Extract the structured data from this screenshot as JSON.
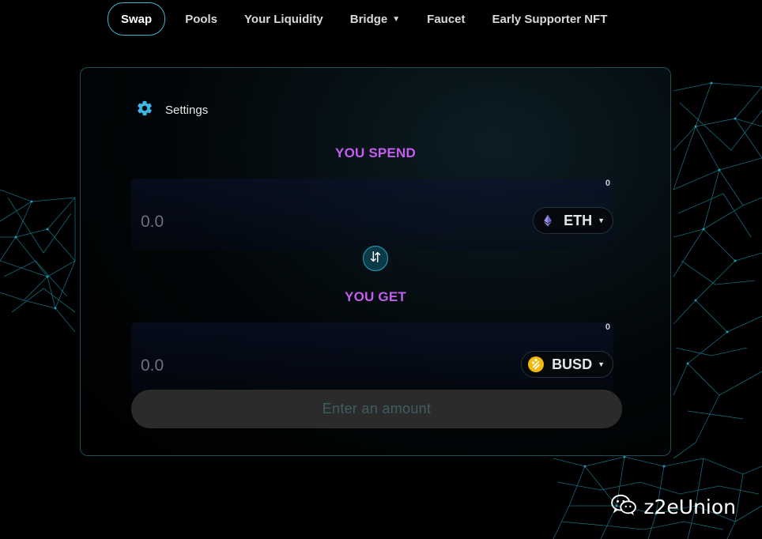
{
  "nav": {
    "items": [
      {
        "label": "Swap",
        "active": true
      },
      {
        "label": "Pools"
      },
      {
        "label": "Your Liquidity"
      },
      {
        "label": "Bridge",
        "has_dropdown": true
      },
      {
        "label": "Faucet"
      },
      {
        "label": "Early Supporter NFT"
      }
    ]
  },
  "swap": {
    "settings_label": "Settings",
    "spend": {
      "title": "YOU SPEND",
      "balance": "0",
      "amount_placeholder": "0.0",
      "token": "ETH",
      "token_icon": "ethereum-icon"
    },
    "get": {
      "title": "YOU GET",
      "balance": "0",
      "amount_placeholder": "0.0",
      "token": "BUSD",
      "token_icon": "busd-icon"
    },
    "submit_label": "Enter an amount"
  },
  "watermark": {
    "text": "z2eUnion",
    "icon": "wechat-icon"
  },
  "colors": {
    "accent": "#3fb5cf",
    "title_purple": "#c65df0",
    "busd_yellow": "#f0b90b"
  }
}
